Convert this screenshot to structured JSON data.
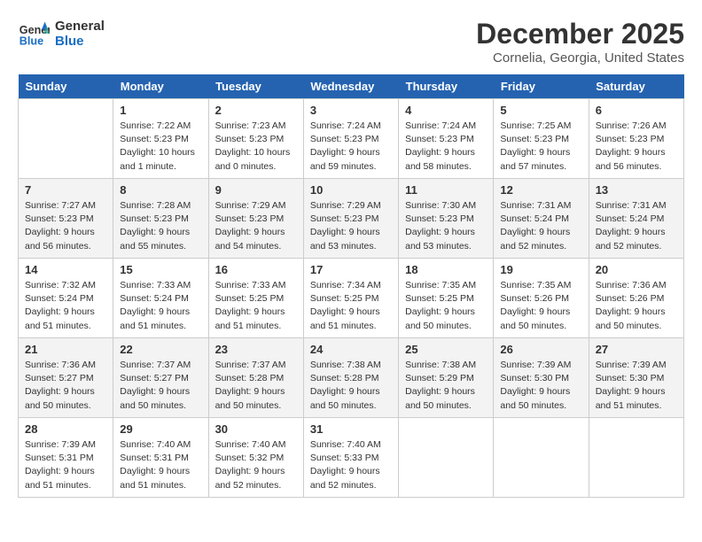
{
  "header": {
    "logo_line1": "General",
    "logo_line2": "Blue",
    "month": "December 2025",
    "location": "Cornelia, Georgia, United States"
  },
  "days_of_week": [
    "Sunday",
    "Monday",
    "Tuesday",
    "Wednesday",
    "Thursday",
    "Friday",
    "Saturday"
  ],
  "weeks": [
    [
      {
        "day": "",
        "info": ""
      },
      {
        "day": "1",
        "info": "Sunrise: 7:22 AM\nSunset: 5:23 PM\nDaylight: 10 hours\nand 1 minute."
      },
      {
        "day": "2",
        "info": "Sunrise: 7:23 AM\nSunset: 5:23 PM\nDaylight: 10 hours\nand 0 minutes."
      },
      {
        "day": "3",
        "info": "Sunrise: 7:24 AM\nSunset: 5:23 PM\nDaylight: 9 hours\nand 59 minutes."
      },
      {
        "day": "4",
        "info": "Sunrise: 7:24 AM\nSunset: 5:23 PM\nDaylight: 9 hours\nand 58 minutes."
      },
      {
        "day": "5",
        "info": "Sunrise: 7:25 AM\nSunset: 5:23 PM\nDaylight: 9 hours\nand 57 minutes."
      },
      {
        "day": "6",
        "info": "Sunrise: 7:26 AM\nSunset: 5:23 PM\nDaylight: 9 hours\nand 56 minutes."
      }
    ],
    [
      {
        "day": "7",
        "info": "Sunrise: 7:27 AM\nSunset: 5:23 PM\nDaylight: 9 hours\nand 56 minutes."
      },
      {
        "day": "8",
        "info": "Sunrise: 7:28 AM\nSunset: 5:23 PM\nDaylight: 9 hours\nand 55 minutes."
      },
      {
        "day": "9",
        "info": "Sunrise: 7:29 AM\nSunset: 5:23 PM\nDaylight: 9 hours\nand 54 minutes."
      },
      {
        "day": "10",
        "info": "Sunrise: 7:29 AM\nSunset: 5:23 PM\nDaylight: 9 hours\nand 53 minutes."
      },
      {
        "day": "11",
        "info": "Sunrise: 7:30 AM\nSunset: 5:23 PM\nDaylight: 9 hours\nand 53 minutes."
      },
      {
        "day": "12",
        "info": "Sunrise: 7:31 AM\nSunset: 5:24 PM\nDaylight: 9 hours\nand 52 minutes."
      },
      {
        "day": "13",
        "info": "Sunrise: 7:31 AM\nSunset: 5:24 PM\nDaylight: 9 hours\nand 52 minutes."
      }
    ],
    [
      {
        "day": "14",
        "info": "Sunrise: 7:32 AM\nSunset: 5:24 PM\nDaylight: 9 hours\nand 51 minutes."
      },
      {
        "day": "15",
        "info": "Sunrise: 7:33 AM\nSunset: 5:24 PM\nDaylight: 9 hours\nand 51 minutes."
      },
      {
        "day": "16",
        "info": "Sunrise: 7:33 AM\nSunset: 5:25 PM\nDaylight: 9 hours\nand 51 minutes."
      },
      {
        "day": "17",
        "info": "Sunrise: 7:34 AM\nSunset: 5:25 PM\nDaylight: 9 hours\nand 51 minutes."
      },
      {
        "day": "18",
        "info": "Sunrise: 7:35 AM\nSunset: 5:25 PM\nDaylight: 9 hours\nand 50 minutes."
      },
      {
        "day": "19",
        "info": "Sunrise: 7:35 AM\nSunset: 5:26 PM\nDaylight: 9 hours\nand 50 minutes."
      },
      {
        "day": "20",
        "info": "Sunrise: 7:36 AM\nSunset: 5:26 PM\nDaylight: 9 hours\nand 50 minutes."
      }
    ],
    [
      {
        "day": "21",
        "info": "Sunrise: 7:36 AM\nSunset: 5:27 PM\nDaylight: 9 hours\nand 50 minutes."
      },
      {
        "day": "22",
        "info": "Sunrise: 7:37 AM\nSunset: 5:27 PM\nDaylight: 9 hours\nand 50 minutes."
      },
      {
        "day": "23",
        "info": "Sunrise: 7:37 AM\nSunset: 5:28 PM\nDaylight: 9 hours\nand 50 minutes."
      },
      {
        "day": "24",
        "info": "Sunrise: 7:38 AM\nSunset: 5:28 PM\nDaylight: 9 hours\nand 50 minutes."
      },
      {
        "day": "25",
        "info": "Sunrise: 7:38 AM\nSunset: 5:29 PM\nDaylight: 9 hours\nand 50 minutes."
      },
      {
        "day": "26",
        "info": "Sunrise: 7:39 AM\nSunset: 5:30 PM\nDaylight: 9 hours\nand 50 minutes."
      },
      {
        "day": "27",
        "info": "Sunrise: 7:39 AM\nSunset: 5:30 PM\nDaylight: 9 hours\nand 51 minutes."
      }
    ],
    [
      {
        "day": "28",
        "info": "Sunrise: 7:39 AM\nSunset: 5:31 PM\nDaylight: 9 hours\nand 51 minutes."
      },
      {
        "day": "29",
        "info": "Sunrise: 7:40 AM\nSunset: 5:31 PM\nDaylight: 9 hours\nand 51 minutes."
      },
      {
        "day": "30",
        "info": "Sunrise: 7:40 AM\nSunset: 5:32 PM\nDaylight: 9 hours\nand 52 minutes."
      },
      {
        "day": "31",
        "info": "Sunrise: 7:40 AM\nSunset: 5:33 PM\nDaylight: 9 hours\nand 52 minutes."
      },
      {
        "day": "",
        "info": ""
      },
      {
        "day": "",
        "info": ""
      },
      {
        "day": "",
        "info": ""
      }
    ]
  ]
}
